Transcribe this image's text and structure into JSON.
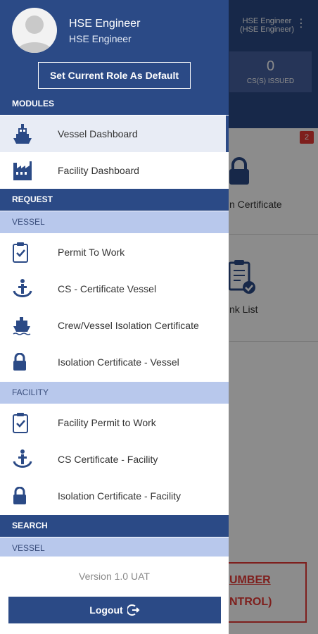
{
  "background": {
    "user_line1": "HSE Engineer",
    "user_line2": "(HSE Engineer)",
    "stat_value": "0",
    "stat_label": "CS(S) ISSUED",
    "badge": "2",
    "tile1_label": "n Certificate",
    "tile2_label": "nk List",
    "red_text_line1": "UMBER",
    "red_text_line2": "NTROL)"
  },
  "drawer": {
    "user_name": "HSE Engineer",
    "user_role": "HSE Engineer",
    "role_button": "Set Current Role As Default",
    "modules_header": "MODULES",
    "modules": [
      {
        "label": "Vessel Dashboard",
        "icon": "vessel-icon"
      },
      {
        "label": "Facility Dashboard",
        "icon": "factory-icon"
      }
    ],
    "request_header": "REQUEST",
    "vessel_subheader": "VESSEL",
    "vessel_items": [
      {
        "label": "Permit To Work",
        "icon": "clipboard-check-icon"
      },
      {
        "label": "CS - Certificate Vessel",
        "icon": "anchor-person-icon"
      },
      {
        "label": "Crew/Vessel Isolation Certificate",
        "icon": "ship-icon"
      },
      {
        "label": "Isolation Certificate - Vessel",
        "icon": "lock-icon"
      }
    ],
    "facility_subheader": "FACILITY",
    "facility_items": [
      {
        "label": "Facility Permit to Work",
        "icon": "clipboard-check-icon"
      },
      {
        "label": "CS Certificate - Facility",
        "icon": "anchor-person-icon"
      },
      {
        "label": "Isolation Certificate - Facility",
        "icon": "lock-icon"
      }
    ],
    "search_header": "SEARCH",
    "search_vessel_subheader": "VESSEL",
    "version": "Version 1.0 UAT",
    "logout": "Logout"
  },
  "colors": {
    "primary": "#2b4a86",
    "subheader": "#b8c8ec",
    "badge": "#e53935"
  }
}
